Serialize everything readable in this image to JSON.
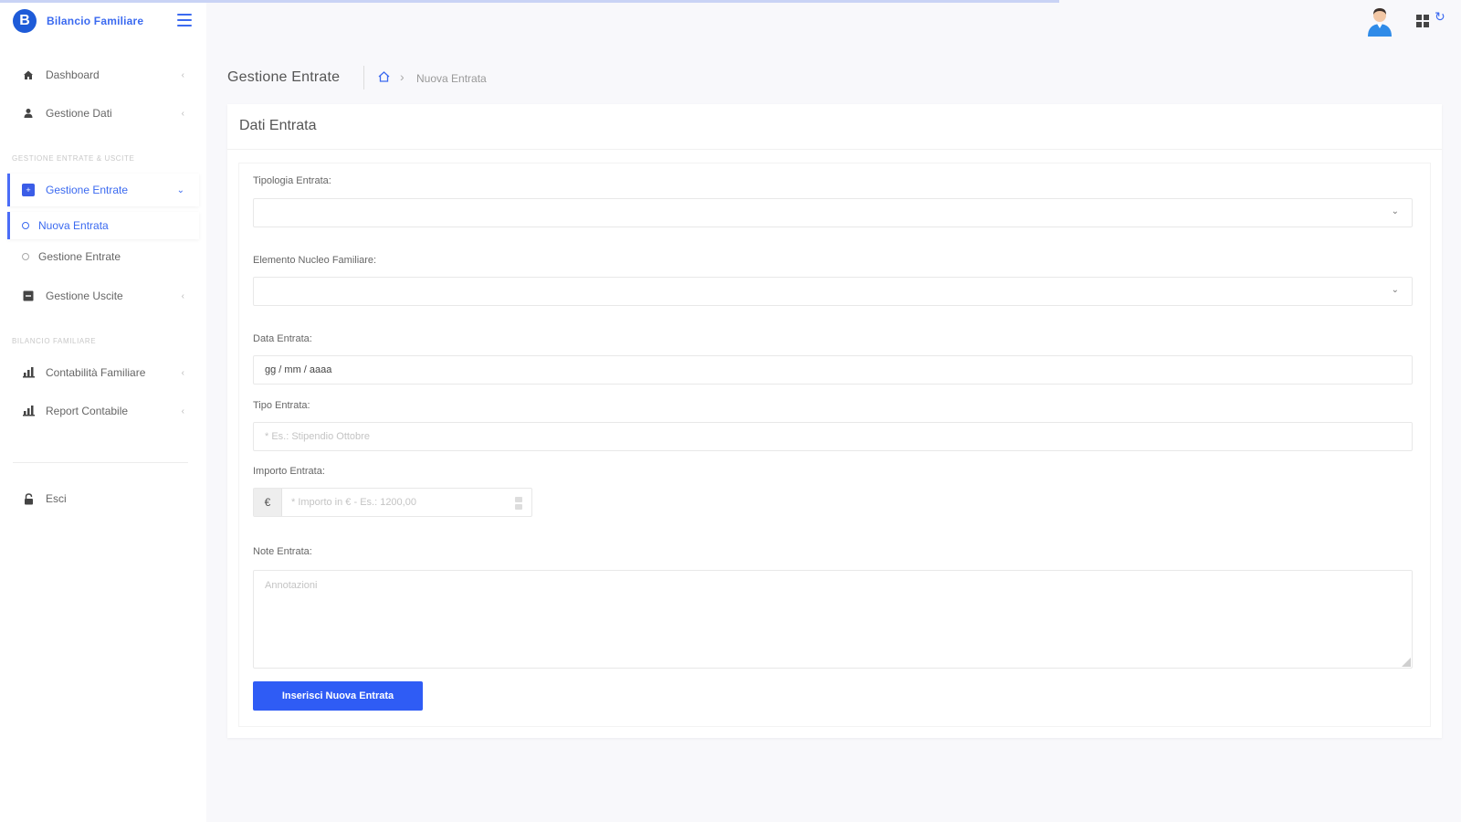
{
  "app": {
    "title": "Bilancio Familiare",
    "logo_letter": "B"
  },
  "sidebar": {
    "items": [
      {
        "label": "Dashboard"
      },
      {
        "label": "Gestione Dati"
      }
    ],
    "section_entrate_uscite": "Gestione Entrate & Uscite",
    "entrate": {
      "label": "Gestione Entrate",
      "sub": [
        {
          "label": "Nuova Entrata"
        },
        {
          "label": "Gestione Entrate"
        }
      ]
    },
    "uscite": {
      "label": "Gestione Uscite"
    },
    "section_bilancio": "Bilancio Familiare",
    "bilancio_items": [
      {
        "label": "Contabilità Familiare"
      },
      {
        "label": "Report Contabile"
      }
    ],
    "exit": {
      "label": "Esci"
    }
  },
  "breadcrumb": {
    "title": "Gestione Entrate",
    "current": "Nuova Entrata"
  },
  "card": {
    "title": "Dati Entrata"
  },
  "form": {
    "tipologia_label": "Tipologia Entrata:",
    "tipologia_value": "",
    "componente_label": "Elemento Nucleo Familiare:",
    "componente_value": "",
    "data_label": "Data Entrata:",
    "data_value": "gg / mm / aaaa",
    "tipo_label": "Tipo Entrata:",
    "tipo_placeholder": "* Es.: Stipendio Ottobre",
    "importo_label": "Importo Entrata:",
    "importo_currency": "€",
    "importo_placeholder": "* Importo in € - Es.: 1200,00",
    "note_label": "Note Entrata:",
    "note_placeholder": "Annotazioni",
    "submit_label": "Inserisci Nuova Entrata"
  },
  "colors": {
    "accent": "#2f5cf5",
    "brand": "#1e5bd8",
    "sidebar_bg": "#ffffff",
    "page_bg": "#f8f8fb"
  }
}
